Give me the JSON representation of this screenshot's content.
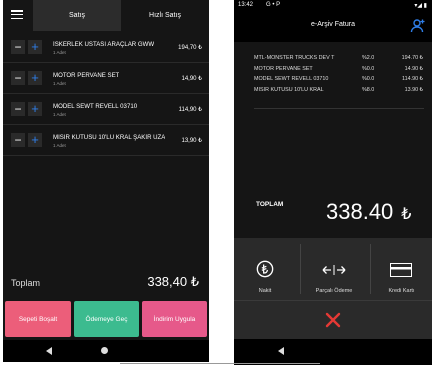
{
  "left_app": {
    "tabs": [
      {
        "label": "Satış",
        "active": true
      },
      {
        "label": "Hızlı Satış",
        "active": false
      }
    ],
    "cart_items": [
      {
        "name": "İSKERLEK USTASI ARAÇLAR GWW",
        "qty": "1 Adet",
        "price": "194,70 ₺"
      },
      {
        "name": "MOTOR PERVANE SET",
        "qty": "1 Adet",
        "price": "14,90 ₺"
      },
      {
        "name": "MODEL SEWT REVELL 03710",
        "qty": "1 Adet",
        "price": "114,90 ₺"
      },
      {
        "name": "MISIR KUTUSU 10'LU KRAL ŞAKİR UZA",
        "qty": "1 Adet",
        "price": "13,90 ₺"
      }
    ],
    "minus_glyph": "−",
    "plus_glyph": "+",
    "total_label": "Toplam",
    "total_value": "338,40 ₺",
    "buttons": {
      "clear": "Sepeti Boşalt",
      "pay": "Ödemeye Geç",
      "discount": "İndirim Uygula"
    },
    "colors": {
      "clear": "#ec5e7a",
      "pay": "#3cbb8f",
      "discount": "#e6598a",
      "plus_accent": "#2f7ee8"
    }
  },
  "right_app": {
    "status_bar": {
      "time": "13:42",
      "icons_left": "G  •  P",
      "icons_right": "▾◢ ▮"
    },
    "title": "e-Arşiv Fatura",
    "invoice_lines": [
      {
        "name": "MTL-MONSTER TRUCKS DEV T",
        "rate": "%2.0",
        "price": "194.70 ₺"
      },
      {
        "name": "MOTOR PERVANE SET",
        "rate": "%0.0",
        "price": "14.90 ₺"
      },
      {
        "name": "MODEL SEWT REVELL 03710",
        "rate": "%0.0",
        "price": "114.90 ₺"
      },
      {
        "name": "MISIR KUTUSU 10'LU KRAL",
        "rate": "%8.0",
        "price": "13.90 ₺"
      }
    ],
    "total_label": "TOPLAM",
    "total_amount": "338.40",
    "total_currency": "₺",
    "payment_methods": [
      {
        "label": "Nakit",
        "icon": "lira-circle-icon"
      },
      {
        "label": "Parçalı Ödeme",
        "icon": "split-arrows-icon"
      },
      {
        "label": "Kredi Kartı",
        "icon": "credit-card-icon"
      }
    ],
    "colors": {
      "accent": "#2f7ee8",
      "cancel": "#e53935"
    }
  }
}
